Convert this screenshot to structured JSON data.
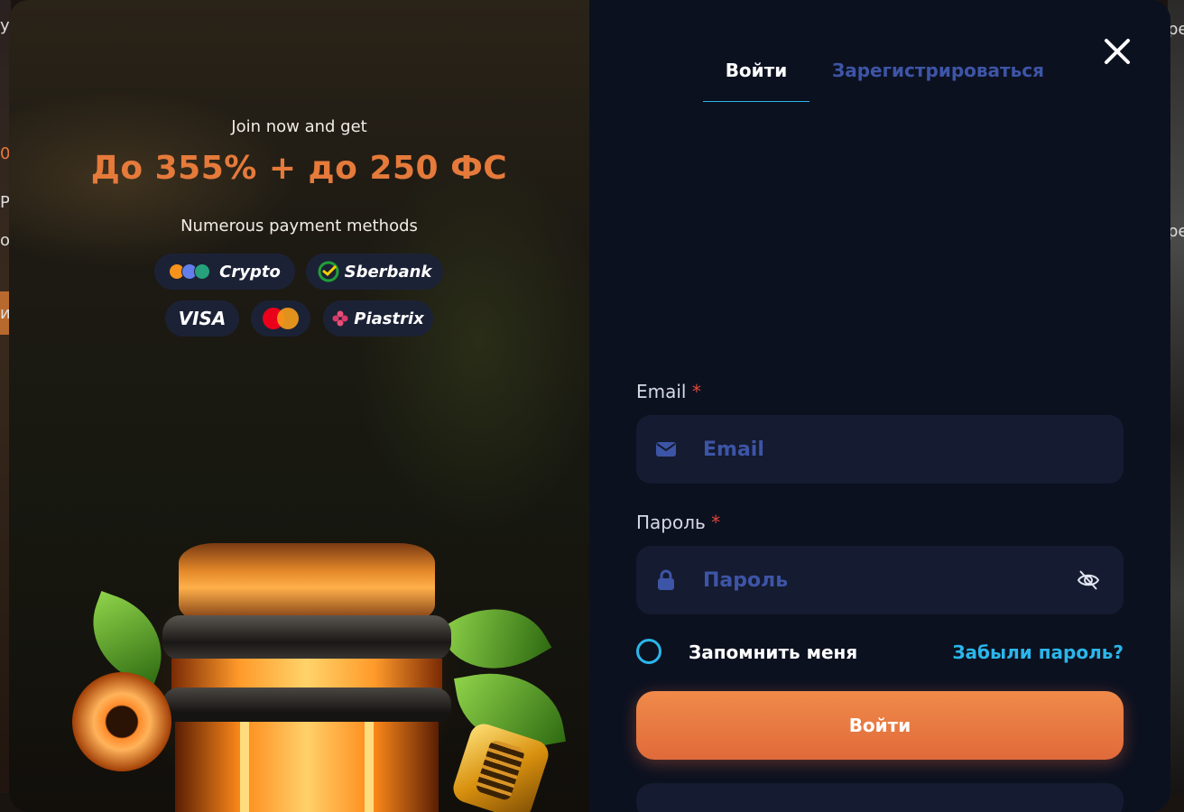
{
  "background": {
    "left_fragments": [
      "у",
      "0",
      "Р",
      "о",
      "ия"
    ],
    "right_fragments": [
      "ре",
      "ре"
    ]
  },
  "promo": {
    "subtitle": "Join now and get",
    "bonus": "До 355% + до 250 ФС",
    "payment_title": "Numerous payment methods",
    "payments": {
      "crypto": "Crypto",
      "sberbank": "Sberbank",
      "visa": "VISA",
      "piastrix": "Piastrix"
    }
  },
  "tabs": {
    "login": "Войти",
    "register": "Зарегистрироваться"
  },
  "form": {
    "email_label": "Email",
    "email_placeholder": "Email",
    "password_label": "Пароль",
    "password_placeholder": "Пароль",
    "required_mark": "*",
    "remember_label": "Запомнить меня",
    "forgot_label": "Забыли пароль?",
    "submit_label": "Войти"
  },
  "colors": {
    "accent_orange": "#e57a3b",
    "accent_cyan": "#2bb6ea",
    "placeholder_blue": "#3d55a6",
    "required_red": "#e0473a"
  },
  "icons": [
    "close-icon",
    "envelope-icon",
    "lock-icon",
    "eye-off-icon",
    "bitcoin-icon",
    "ethereum-icon",
    "tether-icon",
    "sberbank-icon",
    "mastercard-icon",
    "piastrix-icon"
  ]
}
